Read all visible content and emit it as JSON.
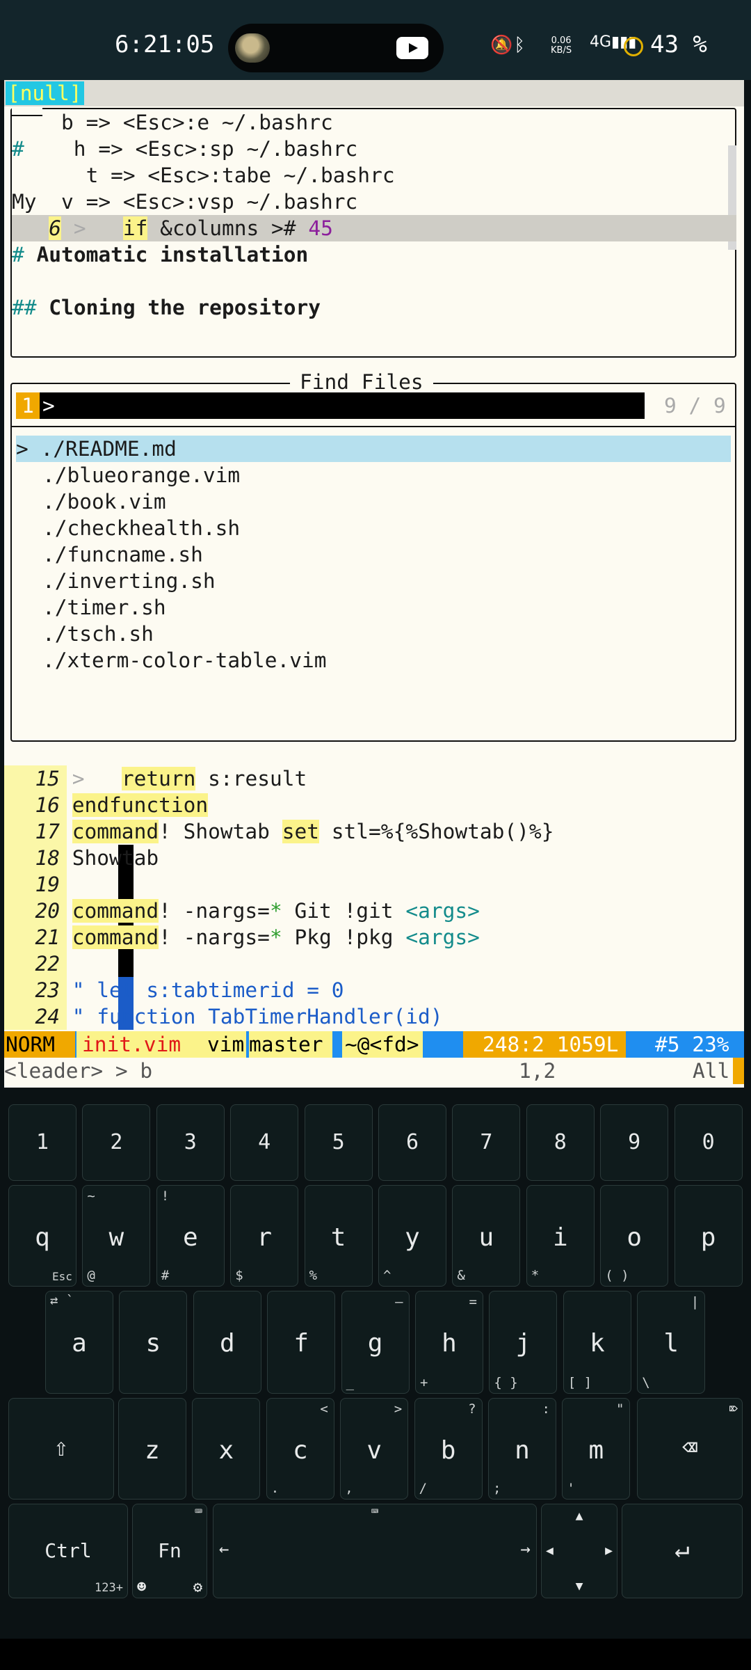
{
  "status_bar": {
    "time": "6:21:05",
    "network_speed_value": "0.06",
    "network_speed_unit": "KB/S",
    "signal": "4G",
    "battery_percent": "43 %",
    "icons": [
      "mute-icon",
      "bluetooth-icon",
      "signal-icon",
      "battery-saver-icon",
      "youtube-icon"
    ]
  },
  "tabline": {
    "tab_label": "[null]"
  },
  "top_window": {
    "lines": [
      {
        "prefix": "",
        "text": "    b => <Esc>:e ~/.bashrc"
      },
      {
        "prefix": "#",
        "text": "    h => <Esc>:sp ~/.bashrc"
      },
      {
        "prefix": "",
        "text": "    t => <Esc>:tabe ~/.bashrc"
      },
      {
        "prefix": "My",
        "text": "  v => <Esc>:vsp ~/.bashrc"
      }
    ],
    "cursor_line": {
      "number": "6",
      "marker": ">",
      "kw": "if",
      "rest": " &columns >#",
      "num": "45"
    },
    "heading1_hash": "#",
    "heading1": "Automatic installation",
    "heading2_hash": "##",
    "heading2": "Cloning the repository"
  },
  "finder": {
    "title": "Find Files",
    "prompt_index": "1",
    "prompt_symbol": ">",
    "count": "9 / 9",
    "selected_marker": ">",
    "files": [
      "./README.md",
      "./blueorange.vim",
      "./book.vim",
      "./checkhealth.sh",
      "./funcname.sh",
      "./inverting.sh",
      "./timer.sh",
      "./tsch.sh",
      "./xterm-color-table.vim"
    ]
  },
  "code": {
    "lines": [
      {
        "n": "15",
        "marker": ">",
        "parts": [
          {
            "t": "   ",
            "c": ""
          },
          {
            "t": "return",
            "c": "kw-yellow"
          },
          {
            "t": " s:result",
            "c": ""
          }
        ]
      },
      {
        "n": "16",
        "parts": [
          {
            "t": "endfunction",
            "c": "kw-yellow"
          }
        ]
      },
      {
        "n": "17",
        "parts": [
          {
            "t": "command",
            "c": "kw-yellow"
          },
          {
            "t": "! Showtab ",
            "c": ""
          },
          {
            "t": "set",
            "c": "kw-yellow"
          },
          {
            "t": " stl=%{%Showtab()%}",
            "c": ""
          }
        ]
      },
      {
        "n": "18",
        "parts": [
          {
            "t": "Showtab",
            "c": ""
          }
        ]
      },
      {
        "n": "19",
        "parts": []
      },
      {
        "n": "20",
        "parts": [
          {
            "t": "command",
            "c": "kw-yellow"
          },
          {
            "t": "! -nargs=",
            "c": ""
          },
          {
            "t": "*",
            "c": "green"
          },
          {
            "t": " Git !git ",
            "c": ""
          },
          {
            "t": "<args>",
            "c": "teal"
          }
        ]
      },
      {
        "n": "21",
        "parts": [
          {
            "t": "command",
            "c": "kw-yellow"
          },
          {
            "t": "! -nargs=",
            "c": ""
          },
          {
            "t": "*",
            "c": "green"
          },
          {
            "t": " Pkg !pkg ",
            "c": ""
          },
          {
            "t": "<args>",
            "c": "teal"
          }
        ]
      },
      {
        "n": "22",
        "parts": []
      },
      {
        "n": "23",
        "parts": [
          {
            "t": "\" let s:tabtimerid = 0",
            "c": "blue"
          }
        ]
      },
      {
        "n": "24",
        "parts": [
          {
            "t": "\" function TabTimerHandler(id)",
            "c": "blue"
          }
        ]
      }
    ]
  },
  "statusline": {
    "mode": "NORM",
    "filename": "init.vim",
    "filetype": "vim",
    "branch": "master",
    "path": "~@<fd>",
    "position": "248:2 1059L",
    "buffer": "#5 23%"
  },
  "cmdline": {
    "text": "<leader> > b",
    "ruler": "1,2",
    "scroll": "All"
  },
  "keyboard": {
    "row1": [
      "1",
      "2",
      "3",
      "4",
      "5",
      "6",
      "7",
      "8",
      "9",
      "0"
    ],
    "row2": [
      {
        "k": "q",
        "tl": "",
        "bl": "Esc"
      },
      {
        "k": "w",
        "tl": "~",
        "bl": "@"
      },
      {
        "k": "e",
        "tl": "!",
        "bl": "#"
      },
      {
        "k": "r",
        "tl": "",
        "bl": "$"
      },
      {
        "k": "t",
        "tl": "",
        "bl": "%"
      },
      {
        "k": "y",
        "tl": "",
        "bl": "^"
      },
      {
        "k": "u",
        "tl": "",
        "bl": "&"
      },
      {
        "k": "i",
        "tl": "",
        "bl": "*"
      },
      {
        "k": "o",
        "tl": "",
        "bl": "(   )"
      },
      {
        "k": "p",
        "tl": "",
        "bl": ""
      }
    ],
    "row3": [
      {
        "k": "a",
        "tl": "⇄   `",
        "bl": ""
      },
      {
        "k": "s",
        "tl": "",
        "bl": ""
      },
      {
        "k": "d",
        "tl": "",
        "bl": ""
      },
      {
        "k": "f",
        "tl": "",
        "bl": ""
      },
      {
        "k": "g",
        "tr": "–",
        "bl": "_"
      },
      {
        "k": "h",
        "tr": "=",
        "bl": "+"
      },
      {
        "k": "j",
        "tr": "",
        "bl": "{   }"
      },
      {
        "k": "k",
        "tr": "",
        "bl": "[   ]"
      },
      {
        "k": "l",
        "tr": "|",
        "bl": "\\"
      }
    ],
    "row4": [
      {
        "k": "z",
        "tr": "",
        "bl": ""
      },
      {
        "k": "x",
        "tr": "",
        "bl": ""
      },
      {
        "k": "c",
        "tr": "<",
        "bl": "."
      },
      {
        "k": "v",
        "tr": ">",
        "bl": ","
      },
      {
        "k": "b",
        "tr": "?",
        "bl": "/"
      },
      {
        "k": "n",
        "tr": ":",
        "bl": ";"
      },
      {
        "k": "m",
        "tr": "\"",
        "bl": "'"
      }
    ],
    "ctrl": "Ctrl",
    "fn": "Fn",
    "fn_sub": "123+",
    "icons": [
      "shift-icon",
      "backspace-icon",
      "left-arrow-icon",
      "right-arrow-icon",
      "enter-icon",
      "emoji-icon",
      "settings-icon",
      "keyboard-icon"
    ]
  }
}
